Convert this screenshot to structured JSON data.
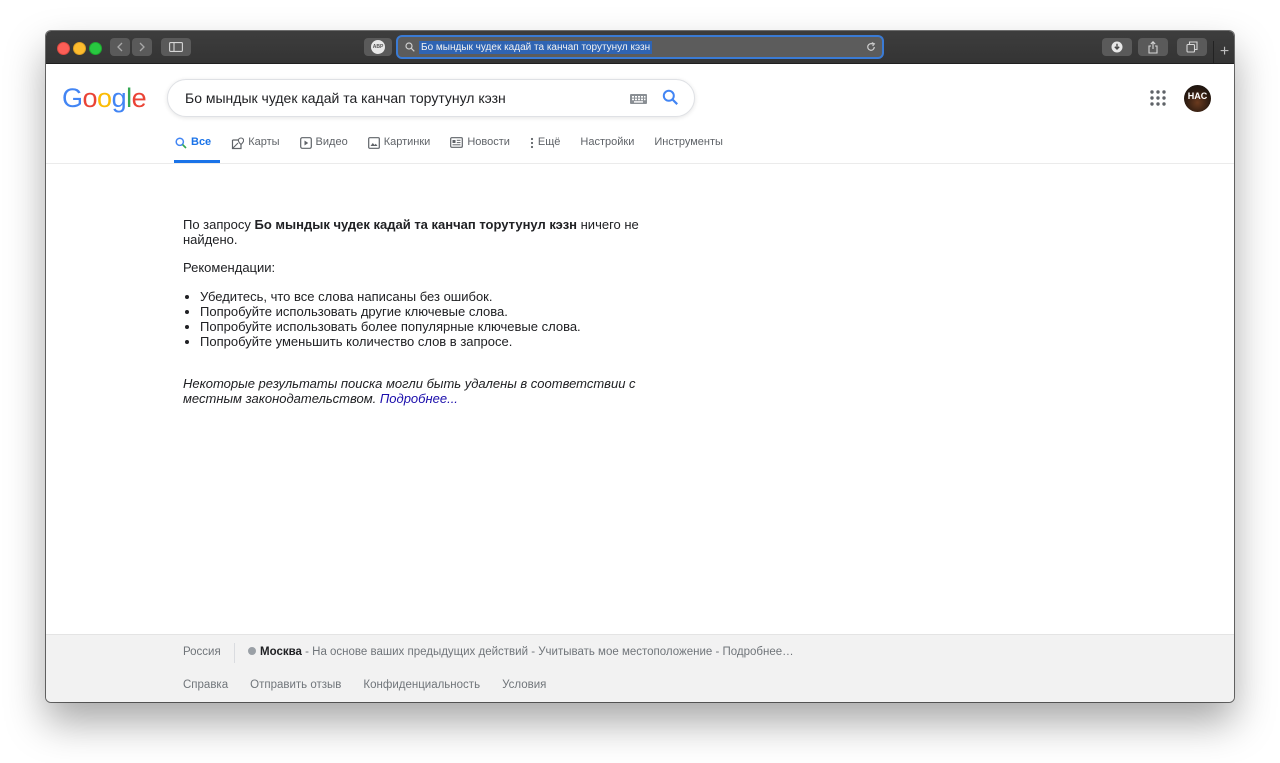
{
  "browser": {
    "address_text": "Бо мындык чудек кадай та канчап торутунул кэзн",
    "abp_label": "ABP",
    "new_tab_label": "+"
  },
  "google": {
    "logo_letters": [
      "G",
      "o",
      "o",
      "g",
      "l",
      "e"
    ],
    "logo_colors": [
      "#4285F4",
      "#EA4335",
      "#FBBC05",
      "#4285F4",
      "#34A853",
      "#EA4335"
    ],
    "search_query": "Бо мындык чудек кадай та канчап торутунул кэзн",
    "avatar_text": "HAC"
  },
  "tabs": [
    {
      "label": "Все",
      "icon": "search-icon",
      "active": true
    },
    {
      "label": "Карты",
      "icon": "map-icon",
      "active": false
    },
    {
      "label": "Видео",
      "icon": "video-icon",
      "active": false
    },
    {
      "label": "Картинки",
      "icon": "image-icon",
      "active": false
    },
    {
      "label": "Новости",
      "icon": "news-icon",
      "active": false
    },
    {
      "label": "Ещё",
      "icon": "more-vert-icon",
      "active": false
    },
    {
      "label": "Настройки",
      "icon": "",
      "active": false
    },
    {
      "label": "Инструменты",
      "icon": "",
      "active": false
    }
  ],
  "result": {
    "prefix": "По запросу ",
    "query_bold": "Бо мындык чудек кадай та канчап торутунул кэзн",
    "suffix": " ничего не найдено.",
    "recommendations_title": "Рекомендации:",
    "tips": [
      "Убедитесь, что все слова написаны без ошибок.",
      "Попробуйте использовать другие ключевые слова.",
      "Попробуйте использовать более популярные ключевые слова.",
      "Попробуйте уменьшить количество слов в запросе."
    ],
    "note": "Некоторые результаты поиска могли быть удалены в соответствии с местным законодательством. ",
    "note_link": "Подробнее..."
  },
  "footer": {
    "country": "Россия",
    "city": "Москва",
    "location_text": " - На основе ваших предыдущих действий - Учитывать мое местоположение - Подробнее…",
    "links": [
      "Справка",
      "Отправить отзыв",
      "Конфиденциальность",
      "Условия"
    ]
  },
  "colors": {
    "accent": "#1a73e8",
    "link": "#1a0dab",
    "traffic_red": "#fc5f57",
    "traffic_yellow": "#fdbc2e",
    "traffic_green": "#28c840"
  }
}
